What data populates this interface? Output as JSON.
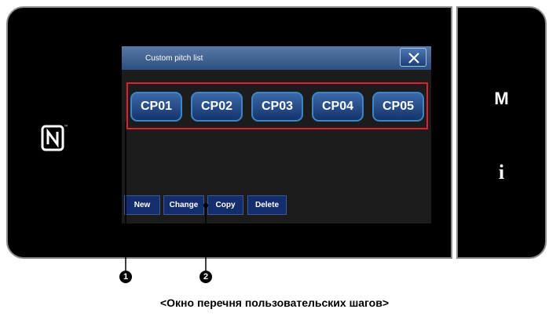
{
  "dialog": {
    "title": "Custom pitch list",
    "close_icon": "close-icon"
  },
  "pitch_buttons": [
    "CP01",
    "CP02",
    "CP03",
    "CP04",
    "CP05"
  ],
  "actions": {
    "new": "New",
    "change": "Change",
    "copy": "Copy",
    "delete": "Delete"
  },
  "side_panel": {
    "m_label": "M",
    "i_label": "i",
    "nfc_icon": "nfc-icon"
  },
  "markers": [
    "1",
    "2"
  ],
  "caption": "<Окно перечня пользовательских шагов>",
  "colors": {
    "highlight": "#e02030",
    "button_blue": "#2a569a",
    "titlebar": "#4a6b9c"
  }
}
